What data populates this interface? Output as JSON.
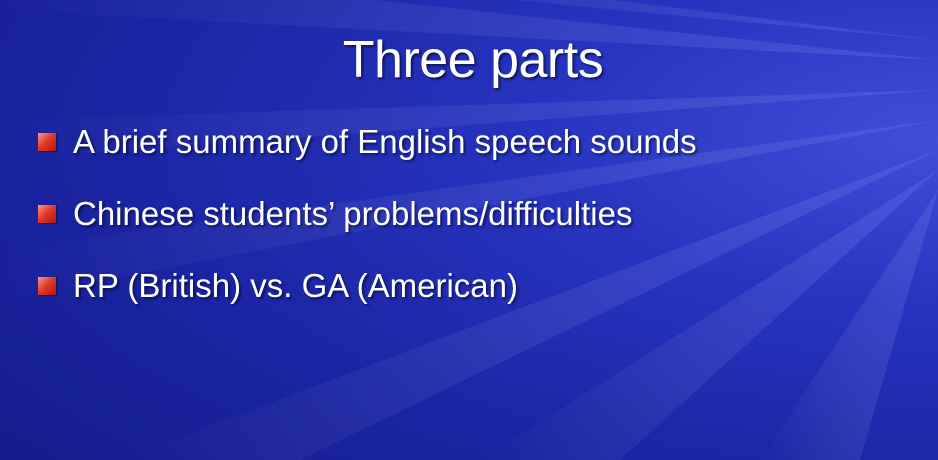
{
  "slide": {
    "title": "Three parts",
    "bullets": [
      {
        "text": "A brief summary of English speech sounds"
      },
      {
        "text": "Chinese students’ problems/difficulties"
      },
      {
        "text": "RP (British) vs. GA (American)"
      }
    ]
  },
  "colors": {
    "background": "#1f2ab0",
    "text": "#ffffff",
    "bullet_marker": "#e23b2d"
  }
}
